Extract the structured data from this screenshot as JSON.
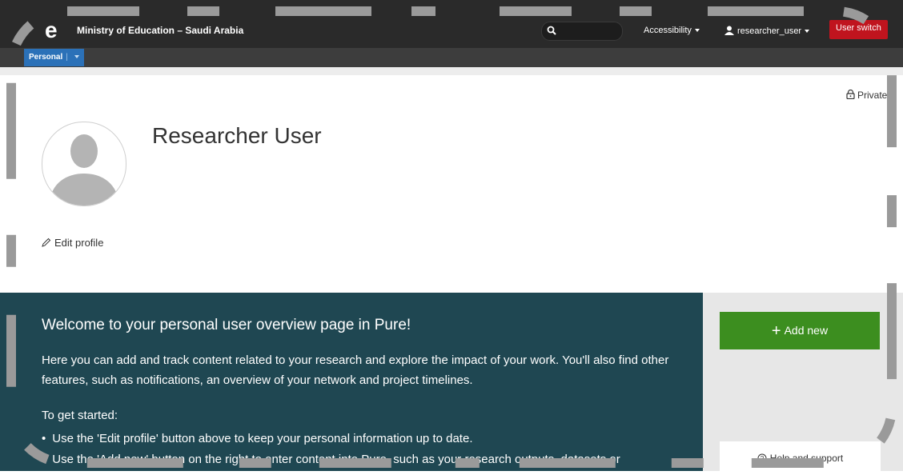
{
  "header": {
    "logo_text": "e",
    "org_name": "Ministry of Education – Saudi Arabia",
    "search": {
      "value": "",
      "icon": "search-icon"
    },
    "accessibility_label": "Accessibility",
    "user_label": "researcher_user",
    "user_switch_label": "User switch",
    "colors": {
      "topbar": "#2a2a2a",
      "user_switch": "#c0141e",
      "tab": "#2b71b8"
    }
  },
  "subnav": {
    "personal_label": "Personal",
    "separator": "|"
  },
  "profile": {
    "private_label": "Private",
    "name": "Researcher User",
    "edit_label": "Edit profile"
  },
  "welcome": {
    "title": "Welcome to your personal user overview page in Pure!",
    "intro": "Here you can add and track content related to your research and explore the impact of your work. You'll also find other features, such as notifications, an overview of your network and project timelines.",
    "started": "To get started:",
    "bullets": [
      "Use the 'Edit profile' button above to keep your personal information up to date.",
      "Use the 'Add new' button on the right to enter content into Pure, such as your research outputs, datasets or"
    ],
    "colors": {
      "panel": "#1f4752"
    }
  },
  "sidebar": {
    "add_new_label": "Add new",
    "help_label": "Help and support",
    "colors": {
      "add_new": "#3c8e1f"
    }
  }
}
